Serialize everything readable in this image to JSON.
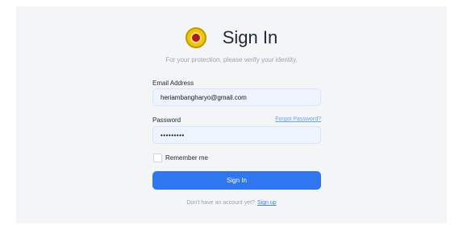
{
  "header": {
    "title": "Sign In",
    "subtitle": "For your protection, please verify your identity."
  },
  "form": {
    "email_label": "Email Address",
    "email_value": "heriambangharyo@gmail.com",
    "password_label": "Password",
    "forgot_link": "Forgot Password?",
    "password_value": "•••••••••",
    "remember_label": "Remember me",
    "remember_checked": false,
    "submit_label": "Sign In"
  },
  "footer": {
    "prompt": "Don't have an account yet?",
    "signup_link": "Sign up"
  },
  "colors": {
    "accent": "#2f76f0",
    "input_bg": "#eef4fd",
    "panel_bg": "#f4f5f7"
  },
  "icons": {
    "logo": "university-seal-logo"
  }
}
